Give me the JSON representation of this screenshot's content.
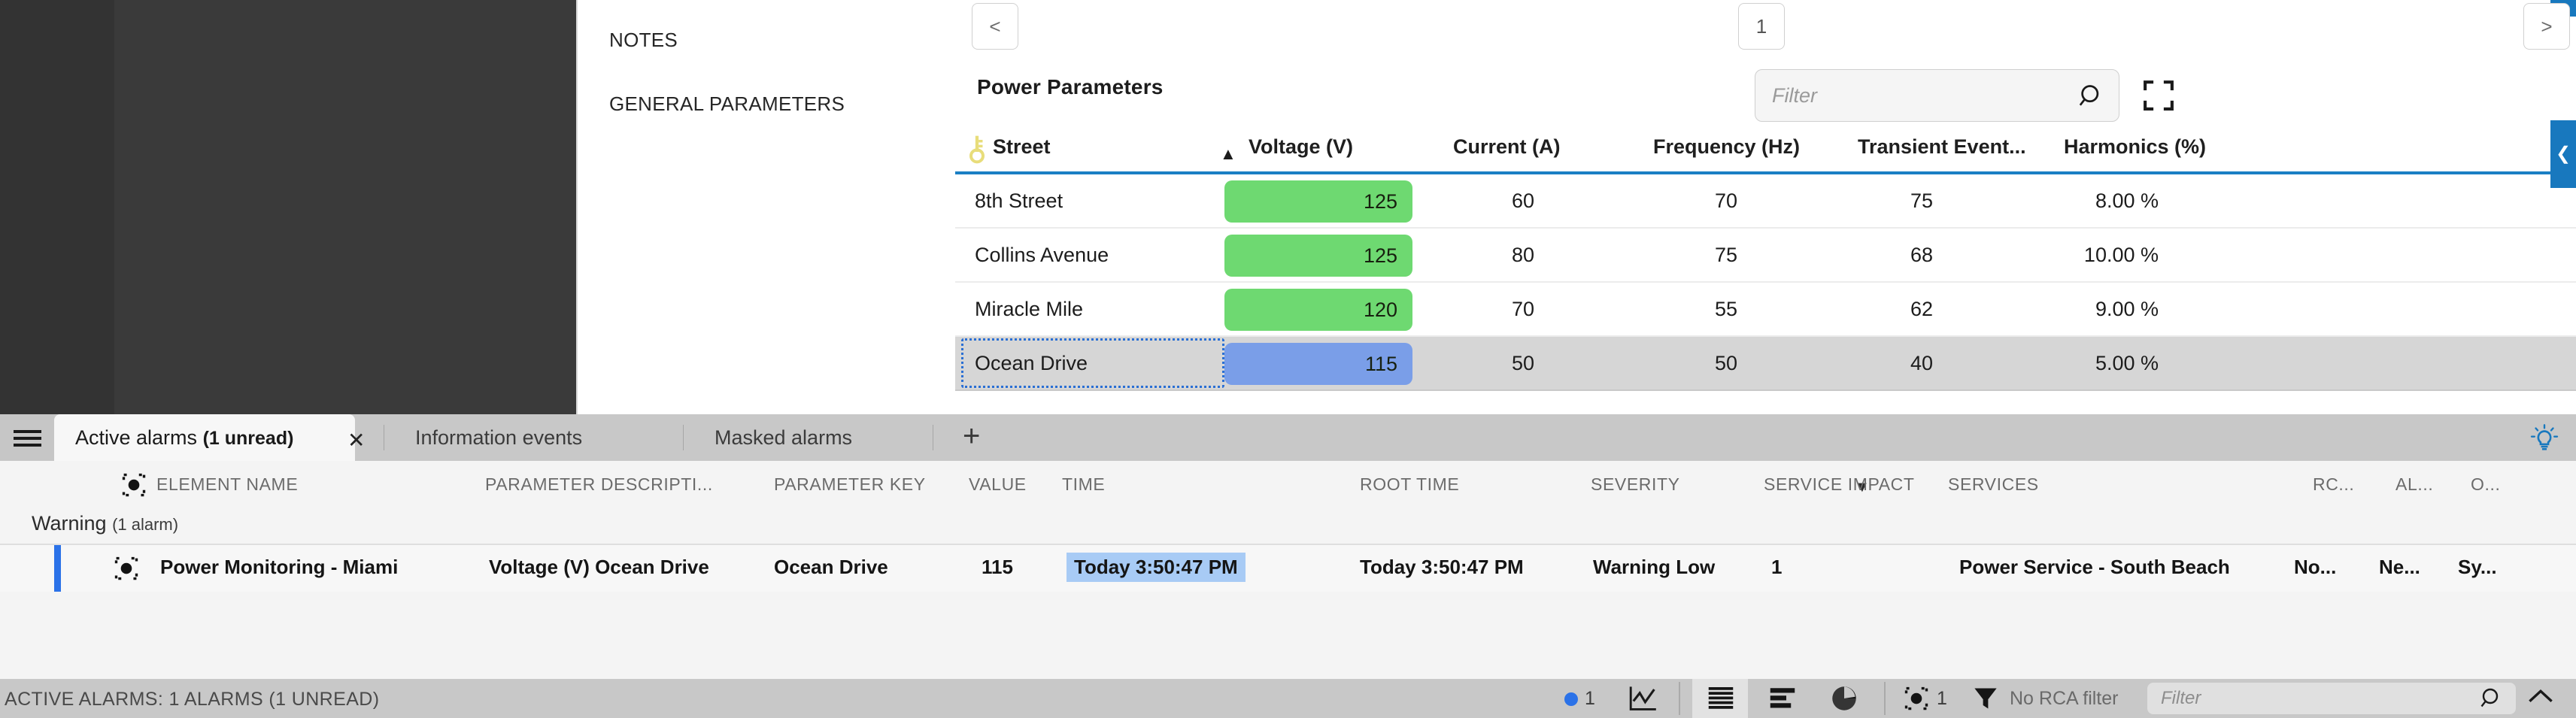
{
  "left_nav": {
    "items": [
      {
        "label": "NOTES"
      },
      {
        "label": "GENERAL PARAMETERS"
      }
    ]
  },
  "pager": {
    "prev_label": "<",
    "page_label": "1",
    "next_label": ">"
  },
  "panel": {
    "title": "Power Parameters",
    "filter_placeholder": "Filter",
    "filter_value": "",
    "search_icon": "search-icon",
    "expand_icon": "fullscreen-icon",
    "collapse_icon": "chevron-left-icon",
    "accent_color": "#1878be"
  },
  "table": {
    "columns": [
      {
        "label": "Street",
        "align": "left",
        "sorted": "asc",
        "key_icon": "key-icon"
      },
      {
        "label": "Voltage (V)",
        "align": "right"
      },
      {
        "label": "Current (A)",
        "align": "right"
      },
      {
        "label": "Frequency (Hz)",
        "align": "right"
      },
      {
        "label": "Transient Event...",
        "align": "right"
      },
      {
        "label": "Harmonics (%)",
        "align": "right"
      }
    ],
    "rows": [
      {
        "street": "8th Street",
        "voltage": "125",
        "voltage_color": "#6ed971",
        "current": "60",
        "frequency": "70",
        "transient": "75",
        "harmonics": "8.00 %",
        "selected": false
      },
      {
        "street": "Collins Avenue",
        "voltage": "125",
        "voltage_color": "#6ed971",
        "current": "80",
        "frequency": "75",
        "transient": "68",
        "harmonics": "10.00 %",
        "selected": false
      },
      {
        "street": "Miracle Mile",
        "voltage": "120",
        "voltage_color": "#6ed971",
        "current": "70",
        "frequency": "55",
        "transient": "62",
        "harmonics": "9.00 %",
        "selected": false
      },
      {
        "street": "Ocean Drive",
        "voltage": "115",
        "voltage_color": "#7a9ee8",
        "current": "50",
        "frequency": "50",
        "transient": "40",
        "harmonics": "5.00 %",
        "selected": true
      }
    ]
  },
  "alarm_tabs": {
    "menu_icon": "hamburger-icon",
    "items": [
      {
        "label": "Active alarms",
        "badge": "(1 unread)",
        "active": true,
        "closable": true
      },
      {
        "label": "Information events",
        "badge": "",
        "active": false,
        "closable": false
      },
      {
        "label": "Masked alarms",
        "badge": "",
        "active": false,
        "closable": false
      }
    ],
    "close_label": "✕",
    "add_label": "+",
    "bulb_icon": "lightbulb-icon"
  },
  "alarm_table": {
    "columns": [
      {
        "label": "ELEMENT NAME"
      },
      {
        "label": "PARAMETER DESCRIPTI..."
      },
      {
        "label": "PARAMETER KEY"
      },
      {
        "label": "VALUE"
      },
      {
        "label": "TIME"
      },
      {
        "label": "ROOT TIME"
      },
      {
        "label": "SEVERITY",
        "sorted": "desc"
      },
      {
        "label": "SERVICE IMPACT"
      },
      {
        "label": "SERVICES"
      },
      {
        "label": "RC..."
      },
      {
        "label": "AL..."
      },
      {
        "label": "O..."
      }
    ],
    "group": {
      "label": "Warning",
      "count": "(1 alarm)"
    },
    "rows": [
      {
        "element_name": "Power Monitoring - Miami",
        "parameter_description": "Voltage (V) Ocean Drive",
        "parameter_key": "Ocean Drive",
        "value": "115",
        "time": "Today 3:50:47 PM",
        "root_time": "Today 3:50:47 PM",
        "severity": "Warning Low",
        "service_impact": "1",
        "services": "Power Service - South Beach",
        "rca": "No...",
        "alarm": "Ne...",
        "other": "Sy...",
        "severity_color": "#2b72e8"
      }
    ]
  },
  "statusbar": {
    "text": "ACTIVE ALARMS: 1 ALARMS (1 UNREAD)",
    "alarm_dot_color": "#2b72e8",
    "alarm_count": "1",
    "trend_icon": "line-chart-icon",
    "table_icon": "table-view-icon",
    "bars_icon": "bar-chart-icon",
    "pie_icon": "pie-chart-icon",
    "element_icon": "element-icon",
    "element_count": "1",
    "filter_icon": "funnel-icon",
    "rca_filter_label": "No RCA filter",
    "filter_placeholder": "Filter",
    "filter_value": "",
    "search_icon": "search-icon",
    "collapse_icon": "chevron-up-icon"
  }
}
